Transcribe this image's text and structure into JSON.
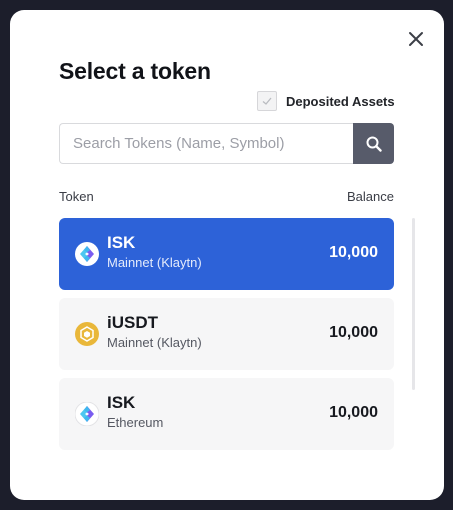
{
  "modal": {
    "title": "Select a token",
    "close_icon": "close-icon",
    "deposited_assets": {
      "label": "Deposited Assets",
      "checked": true
    },
    "search": {
      "placeholder": "Search Tokens (Name, Symbol)",
      "value": "",
      "icon": "search-icon"
    },
    "columns": {
      "token": "Token",
      "balance": "Balance"
    },
    "tokens": [
      {
        "symbol": "ISK",
        "network": "Mainnet (Klaytn)",
        "balance": "10,000",
        "icon": "isk-token-icon",
        "selected": true
      },
      {
        "symbol": "iUSDT",
        "network": "Mainnet (Klaytn)",
        "balance": "10,000",
        "icon": "iusdt-token-icon",
        "selected": false
      },
      {
        "symbol": "ISK",
        "network": "Ethereum",
        "balance": "10,000",
        "icon": "isk-token-icon",
        "selected": false
      }
    ]
  },
  "colors": {
    "accent": "#2d62d8",
    "backdrop": "#1c1e2b",
    "search_button": "#575b6a",
    "iusdt_gold": "#e9b73a"
  }
}
